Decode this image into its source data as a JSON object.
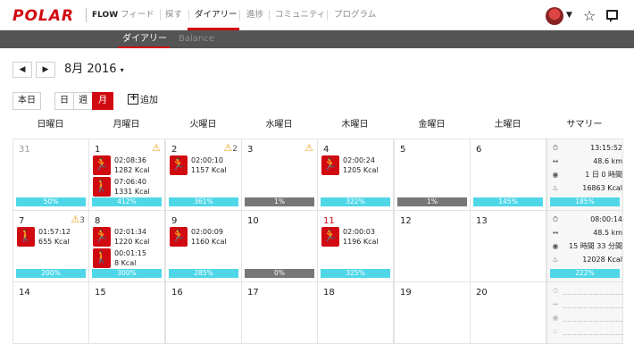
{
  "header": {
    "logo": "POLAR",
    "product": "FLOW",
    "nav": [
      "フィード",
      "探す",
      "ダイアリー",
      "進捗",
      "コミュニティ",
      "プログラム"
    ],
    "active_nav": "ダイアリー"
  },
  "subnav": {
    "items": [
      "ダイアリー",
      "Balance"
    ],
    "active": "ダイアリー"
  },
  "toolbar": {
    "prev": "◀",
    "next": "▶",
    "month": "8月 2016",
    "month_caret": "▾",
    "today": "本日",
    "views": [
      "日",
      "週",
      "月"
    ],
    "selected_view": "月",
    "add": "追加"
  },
  "weekdays": [
    "日曜日",
    "月曜日",
    "火曜日",
    "水曜日",
    "木曜日",
    "金曜日",
    "土曜日",
    "サマリー"
  ],
  "weeks": [
    {
      "days": [
        {
          "num": "31",
          "style": "grey",
          "bar": "50%"
        },
        {
          "num": "1",
          "warn": "",
          "acts": [
            {
              "icon": "run",
              "time": "02:08:36",
              "kcal": "1282 Kcal"
            },
            {
              "icon": "walk",
              "time": "07:06:40",
              "kcal": "1331 Kcal"
            }
          ],
          "bar": "412%"
        },
        {
          "num": "2",
          "warn": "2",
          "acts": [
            {
              "icon": "run",
              "time": "02:00:10",
              "kcal": "1157 Kcal"
            }
          ],
          "bar": "361%"
        },
        {
          "num": "3",
          "warn": "",
          "bar": "1%",
          "bar_grey": true
        },
        {
          "num": "4",
          "acts": [
            {
              "icon": "run",
              "time": "02:00:24",
              "kcal": "1205 Kcal"
            }
          ],
          "bar": "322%"
        },
        {
          "num": "5",
          "bar": "1%",
          "bar_grey": true
        },
        {
          "num": "6",
          "bar": "145%"
        }
      ],
      "summary": {
        "time": "13:15:52",
        "distance": "48.6 km",
        "recovery": "1 日 0 時間",
        "kcal": "16863 Kcal",
        "bar": "185%"
      }
    },
    {
      "days": [
        {
          "num": "7",
          "warn": "3",
          "acts": [
            {
              "icon": "walk",
              "time": "01:57:12",
              "kcal": "655 Kcal"
            }
          ],
          "bar": "200%"
        },
        {
          "num": "8",
          "acts": [
            {
              "icon": "run",
              "time": "02:01:34",
              "kcal": "1220 Kcal"
            },
            {
              "icon": "walk",
              "time": "00:01:15",
              "kcal": "8 Kcal"
            }
          ],
          "bar": "300%"
        },
        {
          "num": "9",
          "acts": [
            {
              "icon": "run",
              "time": "02:00:09",
              "kcal": "1160 Kcal"
            }
          ],
          "bar": "285%"
        },
        {
          "num": "10",
          "bar": "0%",
          "bar_grey": true
        },
        {
          "num": "11",
          "style": "red",
          "acts": [
            {
              "icon": "run",
              "time": "02:00:03",
              "kcal": "1196 Kcal"
            }
          ],
          "bar": "325%"
        },
        {
          "num": "12"
        },
        {
          "num": "13"
        }
      ],
      "summary": {
        "time": "08:00:14",
        "distance": "48.5 km",
        "recovery": "15 時間 33 分間",
        "kcal": "12028 Kcal",
        "bar": "222%"
      }
    },
    {
      "days": [
        {
          "num": "14"
        },
        {
          "num": "15"
        },
        {
          "num": "16"
        },
        {
          "num": "17"
        },
        {
          "num": "18"
        },
        {
          "num": "19"
        },
        {
          "num": "20"
        }
      ],
      "summary": {
        "empty": true
      }
    }
  ],
  "icons": {
    "run": "running-icon",
    "walk": "walking-icon",
    "summary": [
      "stopwatch-icon",
      "distance-icon",
      "recovery-icon",
      "calories-icon"
    ]
  },
  "colors": {
    "brand_red": "#d10a11",
    "bar_cyan": "#4fd7e7",
    "bar_grey": "#777777",
    "warning": "#f0a020"
  }
}
